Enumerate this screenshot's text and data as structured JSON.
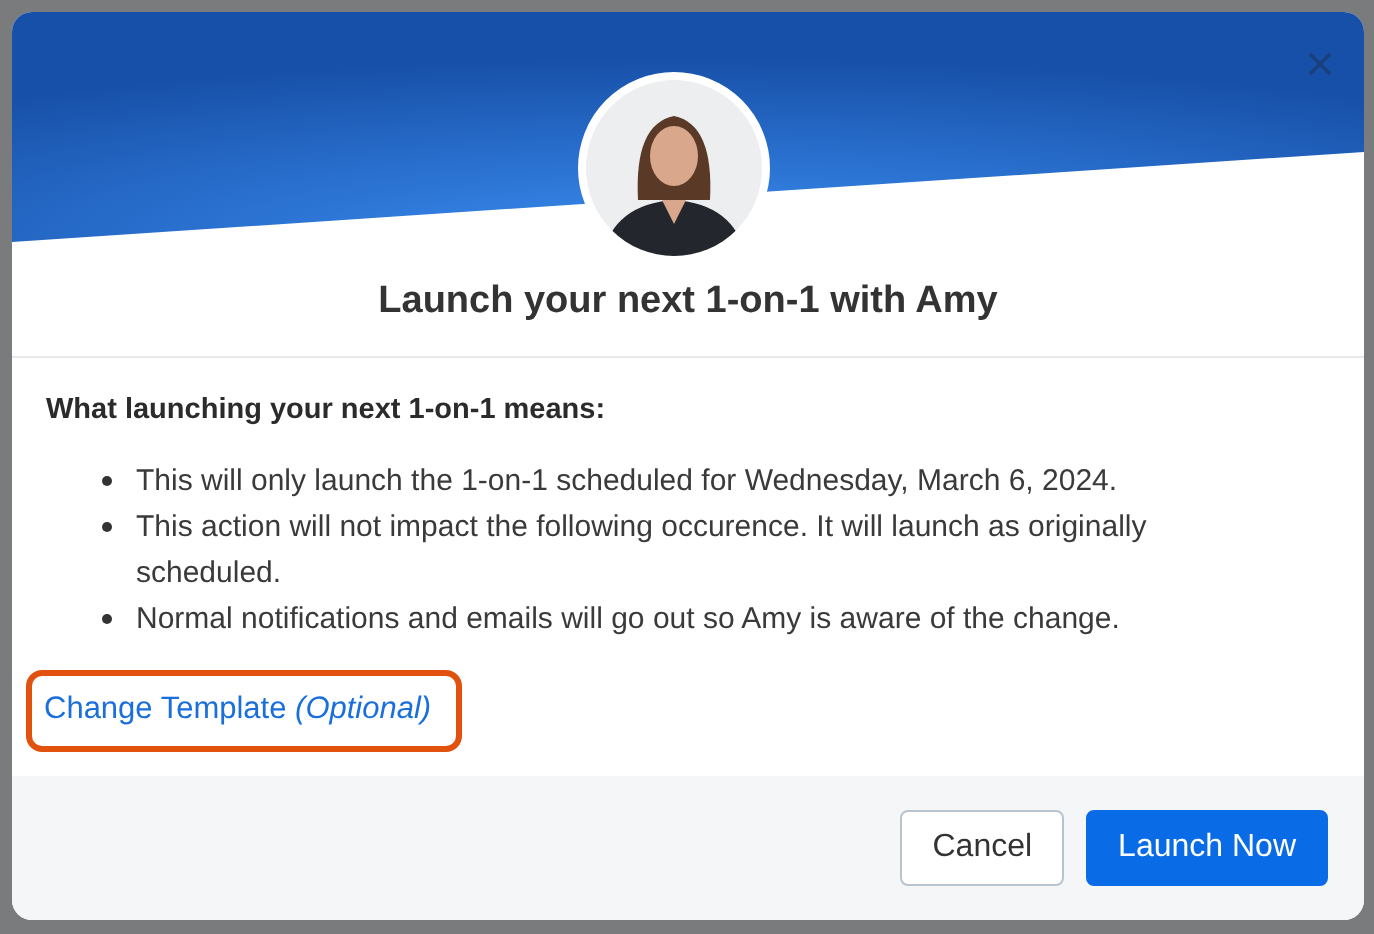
{
  "dialog": {
    "title": "Launch your next 1-on-1 with Amy",
    "heading": "What launching your next 1-on-1 means:",
    "points": [
      "This will only launch the 1-on-1 scheduled for Wednesday, March 6, 2024.",
      "This action will not impact the following occurence. It will launch as originally scheduled.",
      "Normal notifications and emails will go out so Amy is aware of the change."
    ],
    "link": {
      "text": "Change Template *(Optional)*",
      "highlighted": true
    },
    "buttons": [
      {
        "label": "Cancel",
        "kind": "secondary"
      },
      {
        "label": "Launch Now",
        "kind": "primary"
      }
    ]
  }
}
